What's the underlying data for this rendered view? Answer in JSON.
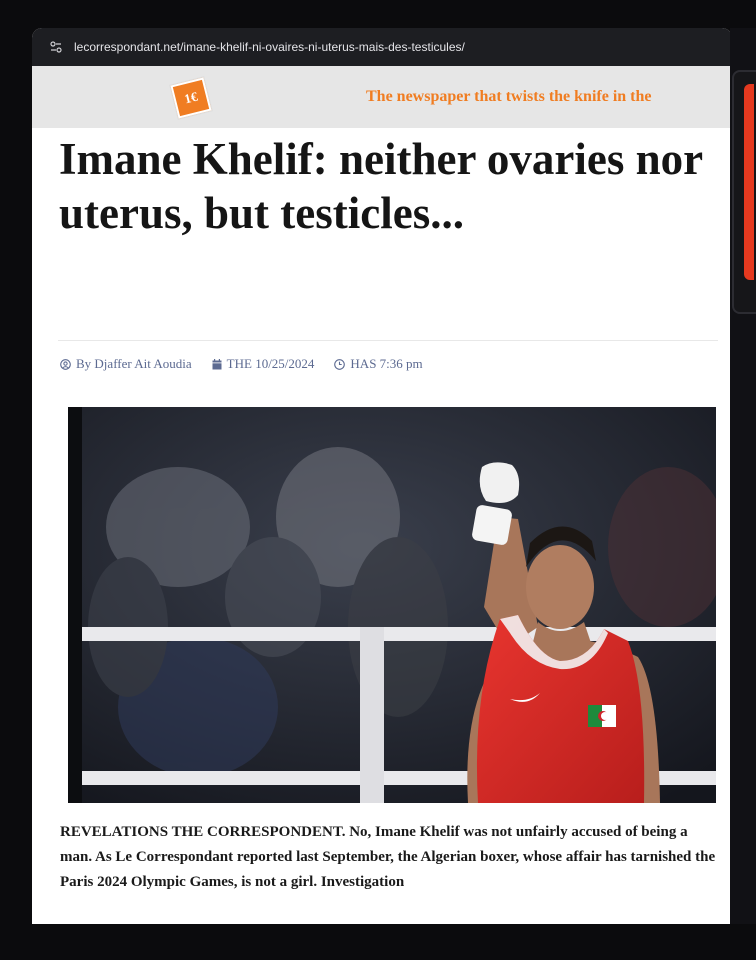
{
  "browser": {
    "url": "lecorrespondant.net/imane-khelif-ni-ovaires-ni-uterus-mais-des-testicules/"
  },
  "site": {
    "logo_text": "1€",
    "tagline": "The newspaper  that twists the knife  in the",
    "accent_color": "#f07d22"
  },
  "article": {
    "headline": "Imane Khelif: neither ovaries nor uterus, but testicles...",
    "author": "By Djaffer Ait Aoudia",
    "date": "THE 10/25/2024",
    "time": "HAS 7:36 pm",
    "photo_alt": "Boxer in red Algeria vest raising a taped fist in the ring",
    "caption": "REVELATIONS THE CORRESPONDENT. No, Imane Khelif was not unfairly accused of being a man. As Le Correspondant reported last September, the Algerian boxer, whose  affair  has tarnished the Paris 2024 Olympic Games, is not a girl. Investigation"
  },
  "icons": {
    "url_icon": "tune-icon",
    "author_icon": "user-circle-icon",
    "date_icon": "calendar-icon",
    "time_icon": "clock-icon"
  }
}
